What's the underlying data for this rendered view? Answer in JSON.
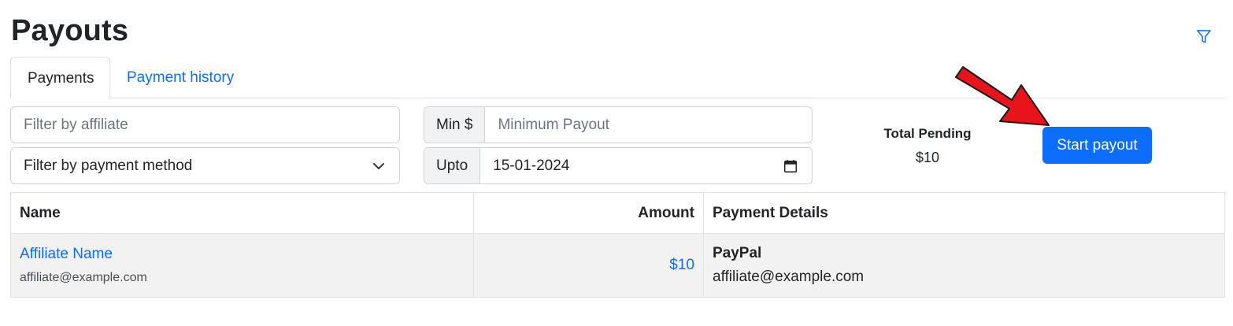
{
  "page": {
    "title": "Payouts"
  },
  "icons": {
    "filter": "filter-funnel-icon",
    "select_caret": "chevron-down-icon",
    "calendar": "calendar-icon"
  },
  "colors": {
    "primary": "#0d6efd",
    "annotation_arrow": "#e8141c",
    "row_bg": "#f2f2f2"
  },
  "tabs": [
    {
      "label": "Payments",
      "active": true
    },
    {
      "label": "Payment history",
      "active": false
    }
  ],
  "filters": {
    "affiliate_placeholder": "Filter by affiliate",
    "payment_method_selected": "Filter by payment method",
    "min_label": "Min $",
    "min_placeholder": "Minimum Payout",
    "upto_label": "Upto",
    "upto_value": "15-01-2024"
  },
  "summary": {
    "label": "Total Pending",
    "value": "$10"
  },
  "actions": {
    "start_payout": "Start payout"
  },
  "table": {
    "columns": [
      "Name",
      "Amount",
      "Payment Details"
    ],
    "rows": [
      {
        "name": "Affiliate Name",
        "email": "affiliate@example.com",
        "amount": "$10",
        "method": "PayPal",
        "details_email": "affiliate@example.com"
      }
    ]
  }
}
